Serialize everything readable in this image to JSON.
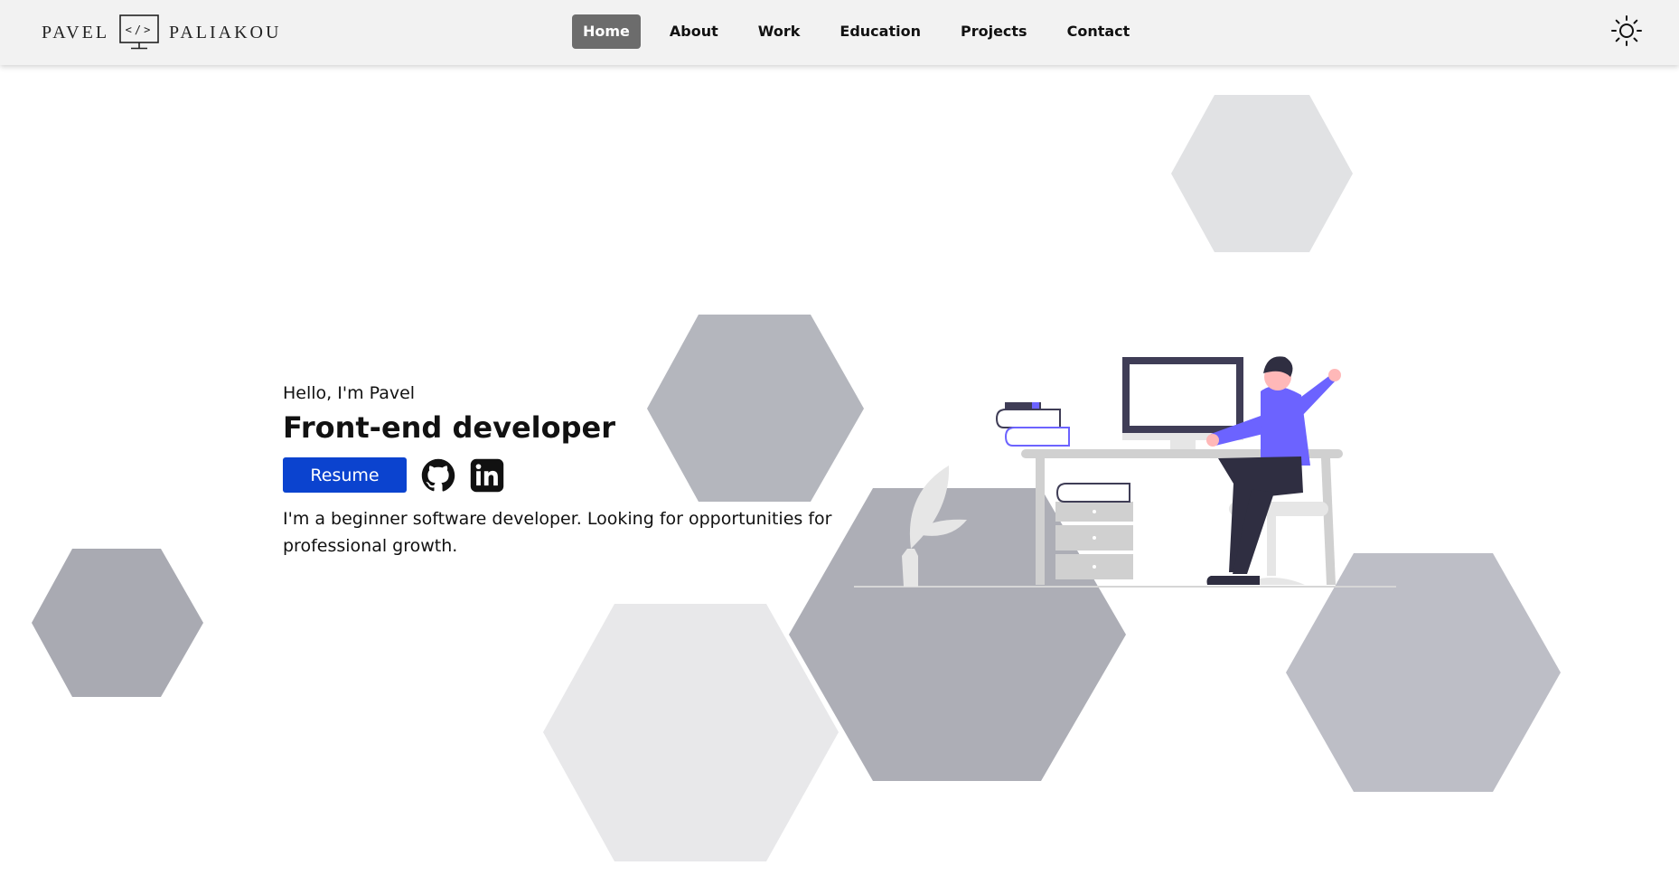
{
  "logo": {
    "first": "PAVEL",
    "last": "PALIAKOU",
    "mark": "</>"
  },
  "nav": {
    "items": [
      "Home",
      "About",
      "Work",
      "Education",
      "Projects",
      "Contact"
    ],
    "active": "Home"
  },
  "hero": {
    "greeting": "Hello, I'm Pavel",
    "title": "Front-end developer",
    "resume_label": "Resume",
    "description": "I'm a beginner software developer. Looking for opportunities for professional growth."
  },
  "icons": {
    "theme": "sun-icon",
    "github": "github-icon",
    "linkedin": "linkedin-icon"
  },
  "colors": {
    "accent": "#0b43cf",
    "nav_active": "#6c6c6c",
    "figure_shirt": "#6c63ff"
  }
}
